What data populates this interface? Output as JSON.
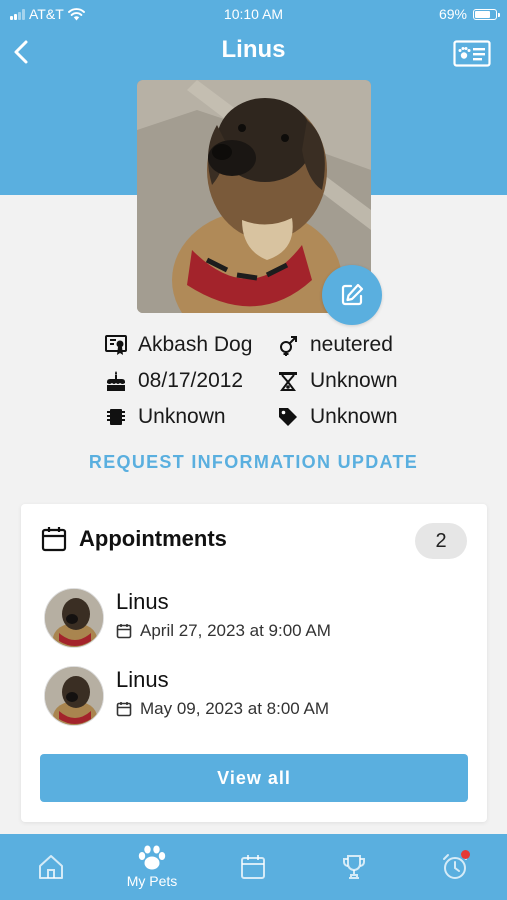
{
  "status_bar": {
    "carrier": "AT&T",
    "time": "10:10 AM",
    "battery": "69%"
  },
  "header": {
    "title": "Linus"
  },
  "pet": {
    "breed": "Akbash Dog",
    "sex": "neutered",
    "birthdate": "08/17/2012",
    "field_4": "Unknown",
    "microchip": "Unknown",
    "tag": "Unknown"
  },
  "request_update_label": "REQUEST INFORMATION UPDATE",
  "appointments": {
    "title": "Appointments",
    "count": "2",
    "items": [
      {
        "name": "Linus",
        "datetime": "April 27, 2023 at 9:00 AM"
      },
      {
        "name": "Linus",
        "datetime": "May 09, 2023 at 8:00 AM"
      }
    ],
    "view_all_label": "View all"
  },
  "tabbar": {
    "items": [
      {
        "icon": "home-icon",
        "label": ""
      },
      {
        "icon": "paw-icon",
        "label": "My Pets"
      },
      {
        "icon": "calendar-icon",
        "label": ""
      },
      {
        "icon": "trophy-icon",
        "label": ""
      },
      {
        "icon": "alarm-clock-icon",
        "label": ""
      }
    ]
  },
  "colors": {
    "accent": "#5aafdf",
    "notification": "#e53935"
  }
}
